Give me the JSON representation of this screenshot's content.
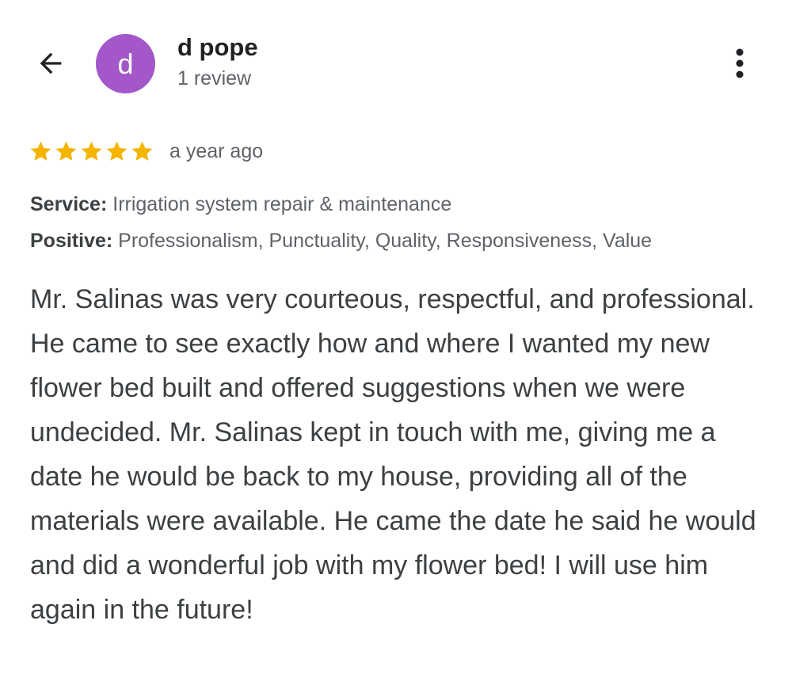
{
  "header": {
    "back_icon": "arrow-back-icon",
    "avatar_letter": "d",
    "avatar_color": "#a357c9",
    "reviewer_name": "d pope",
    "review_count": "1 review",
    "more_icon": "more-vert-icon"
  },
  "review": {
    "rating": 5,
    "rating_max": 5,
    "star_color": "#f4b400",
    "time": "a year ago",
    "service_label": "Service:",
    "service_value": "Irrigation system repair & maintenance",
    "positive_label": "Positive:",
    "positive_value": "Professionalism, Punctuality, Quality, Responsiveness, Value",
    "text": "Mr. Salinas was very courteous, respectful, and professional. He came to see exactly how and where I wanted my new flower bed built and offered suggestions when we were undecided. Mr. Salinas kept in touch with me, giving me a date he would be back to my house, providing all of the materials were available. He came the date he said he would and did a wonderful job with my flower bed! I will use him again in the future!"
  }
}
